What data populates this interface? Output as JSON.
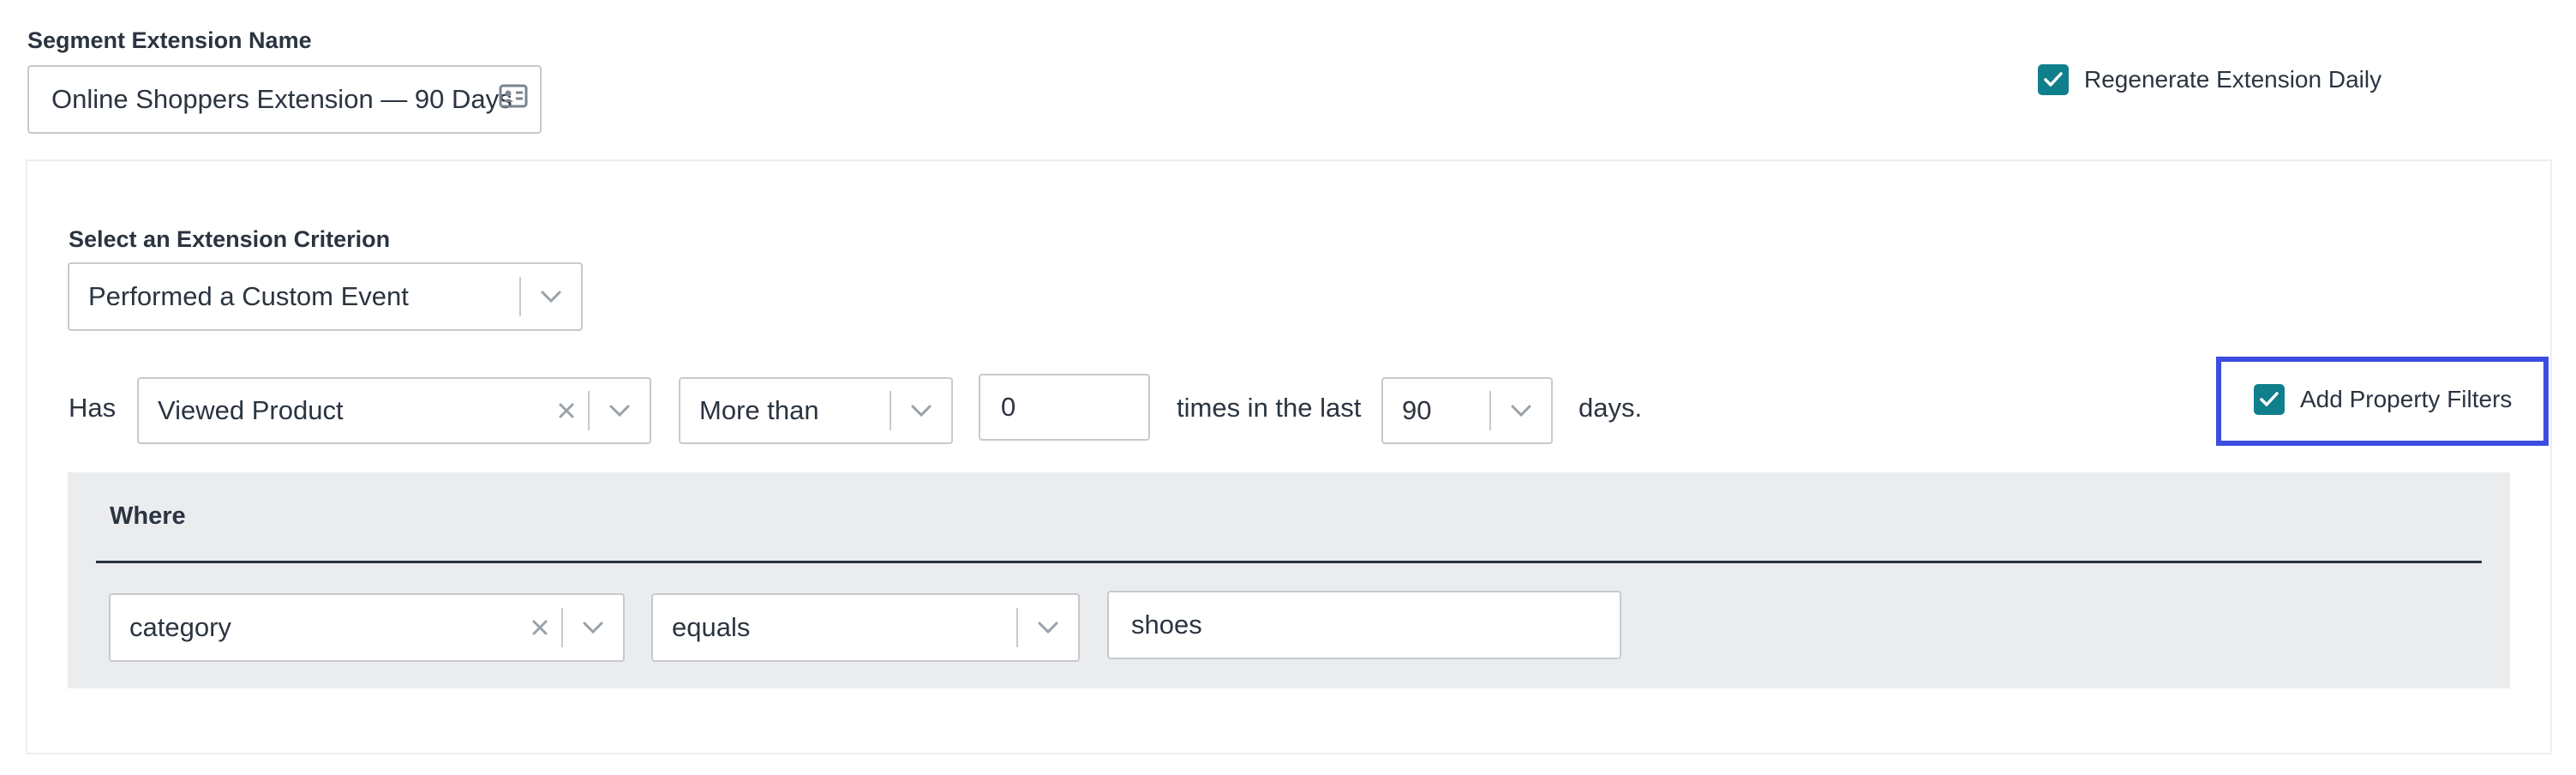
{
  "segment_extension": {
    "name_label": "Segment Extension Name",
    "name_value": "Online Shoppers Extension — 90 Days",
    "name_icon": "contact-card-icon"
  },
  "regenerate": {
    "label": "Regenerate Extension Daily",
    "checked": true
  },
  "criterion": {
    "label": "Select an Extension Criterion",
    "selected": "Performed a Custom Event"
  },
  "rule": {
    "has_label": "Has",
    "event": "Viewed Product",
    "comparison": "More than",
    "count": "0",
    "times_text": "times in the last",
    "days_value": "90",
    "days_text": "days."
  },
  "property_filters": {
    "label": "Add Property Filters",
    "checked": true
  },
  "where": {
    "title": "Where",
    "property": "category",
    "operator": "equals",
    "value": "shoes"
  },
  "colors": {
    "accent": "#0f7f8c",
    "highlight": "#3c4de0",
    "where_bg": "#ebecee"
  }
}
